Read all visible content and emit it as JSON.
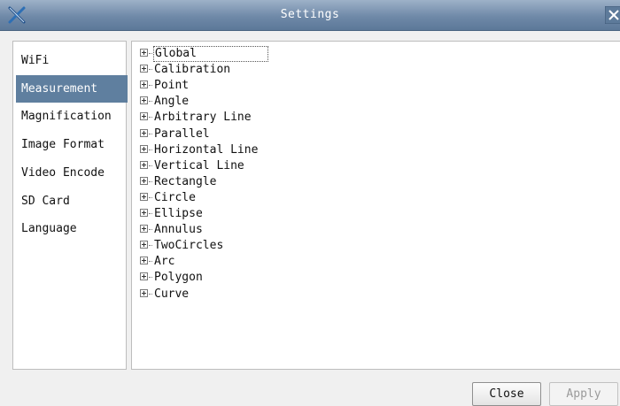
{
  "window": {
    "title": "Settings",
    "logo_icon": "crossed-tools-icon",
    "close_icon": "close-x-icon"
  },
  "sidebar": {
    "items": [
      {
        "label": "WiFi",
        "selected": false
      },
      {
        "label": "Measurement",
        "selected": true
      },
      {
        "label": "Magnification",
        "selected": false
      },
      {
        "label": "Image Format",
        "selected": false
      },
      {
        "label": "Video Encode",
        "selected": false
      },
      {
        "label": "SD Card",
        "selected": false
      },
      {
        "label": "Language",
        "selected": false
      }
    ]
  },
  "tree": {
    "expand_icon": "expand-plus-icon",
    "items": [
      {
        "label": "Global",
        "focused": true
      },
      {
        "label": "Calibration"
      },
      {
        "label": "Point"
      },
      {
        "label": "Angle"
      },
      {
        "label": "Arbitrary Line"
      },
      {
        "label": "Parallel"
      },
      {
        "label": "Horizontal Line"
      },
      {
        "label": "Vertical Line"
      },
      {
        "label": "Rectangle"
      },
      {
        "label": "Circle"
      },
      {
        "label": "Ellipse"
      },
      {
        "label": "Annulus"
      },
      {
        "label": "TwoCircles"
      },
      {
        "label": "Arc"
      },
      {
        "label": "Polygon"
      },
      {
        "label": "Curve"
      }
    ]
  },
  "buttons": {
    "close_label": "Close",
    "apply_label": "Apply",
    "apply_enabled": false
  },
  "colors": {
    "titlebar": "#6f89a8",
    "selected_item": "#5f7f9f"
  }
}
